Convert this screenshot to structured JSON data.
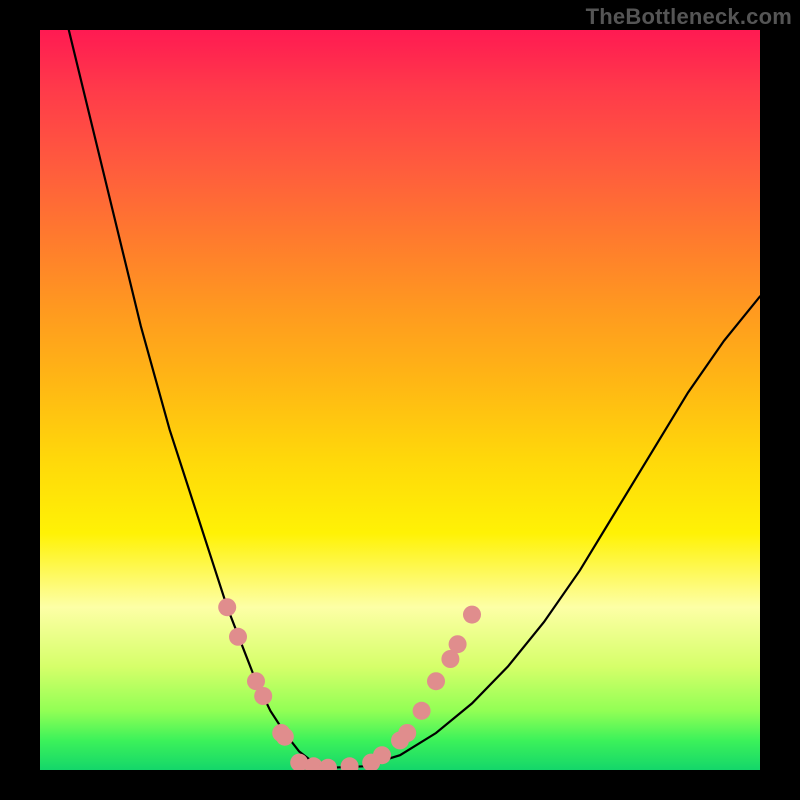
{
  "watermark": "TheBottleneck.com",
  "chart_data": {
    "type": "line",
    "title": "",
    "xlabel": "",
    "ylabel": "",
    "xlim": [
      0,
      100
    ],
    "ylim": [
      0,
      100
    ],
    "background_gradient": {
      "direction": "vertical",
      "stops": [
        {
          "pos": 0,
          "color": "#ff1a52"
        },
        {
          "pos": 18,
          "color": "#ff5a3e"
        },
        {
          "pos": 38,
          "color": "#ff9a1f"
        },
        {
          "pos": 58,
          "color": "#ffd80a"
        },
        {
          "pos": 78,
          "color": "#fdffa6"
        },
        {
          "pos": 92,
          "color": "#92ff55"
        },
        {
          "pos": 100,
          "color": "#14d66a"
        }
      ]
    },
    "series": [
      {
        "name": "bottleneck-curve",
        "stroke": "#000000",
        "stroke_width": 2.2,
        "x": [
          4,
          6,
          8,
          10,
          12,
          14,
          16,
          18,
          20,
          22,
          24,
          26,
          28,
          30,
          32,
          34,
          36,
          38,
          40,
          45,
          50,
          55,
          60,
          65,
          70,
          75,
          80,
          85,
          90,
          95,
          100
        ],
        "y": [
          100,
          92,
          84,
          76,
          68,
          60,
          53,
          46,
          40,
          34,
          28,
          22,
          17,
          12,
          8,
          5,
          2.5,
          1,
          0.3,
          0.5,
          2,
          5,
          9,
          14,
          20,
          27,
          35,
          43,
          51,
          58,
          64
        ]
      }
    ],
    "markers": {
      "name": "highlight-dots",
      "color": "#e08d8d",
      "radius": 9,
      "points": [
        {
          "x": 26,
          "y": 22
        },
        {
          "x": 27.5,
          "y": 18
        },
        {
          "x": 30,
          "y": 12
        },
        {
          "x": 31,
          "y": 10
        },
        {
          "x": 33.5,
          "y": 5
        },
        {
          "x": 34,
          "y": 4.5
        },
        {
          "x": 36,
          "y": 1
        },
        {
          "x": 38,
          "y": 0.5
        },
        {
          "x": 40,
          "y": 0.3
        },
        {
          "x": 43,
          "y": 0.5
        },
        {
          "x": 46,
          "y": 1
        },
        {
          "x": 47.5,
          "y": 2
        },
        {
          "x": 50,
          "y": 4
        },
        {
          "x": 51,
          "y": 5
        },
        {
          "x": 53,
          "y": 8
        },
        {
          "x": 55,
          "y": 12
        },
        {
          "x": 57,
          "y": 15
        },
        {
          "x": 58,
          "y": 17
        },
        {
          "x": 60,
          "y": 21
        }
      ]
    }
  }
}
